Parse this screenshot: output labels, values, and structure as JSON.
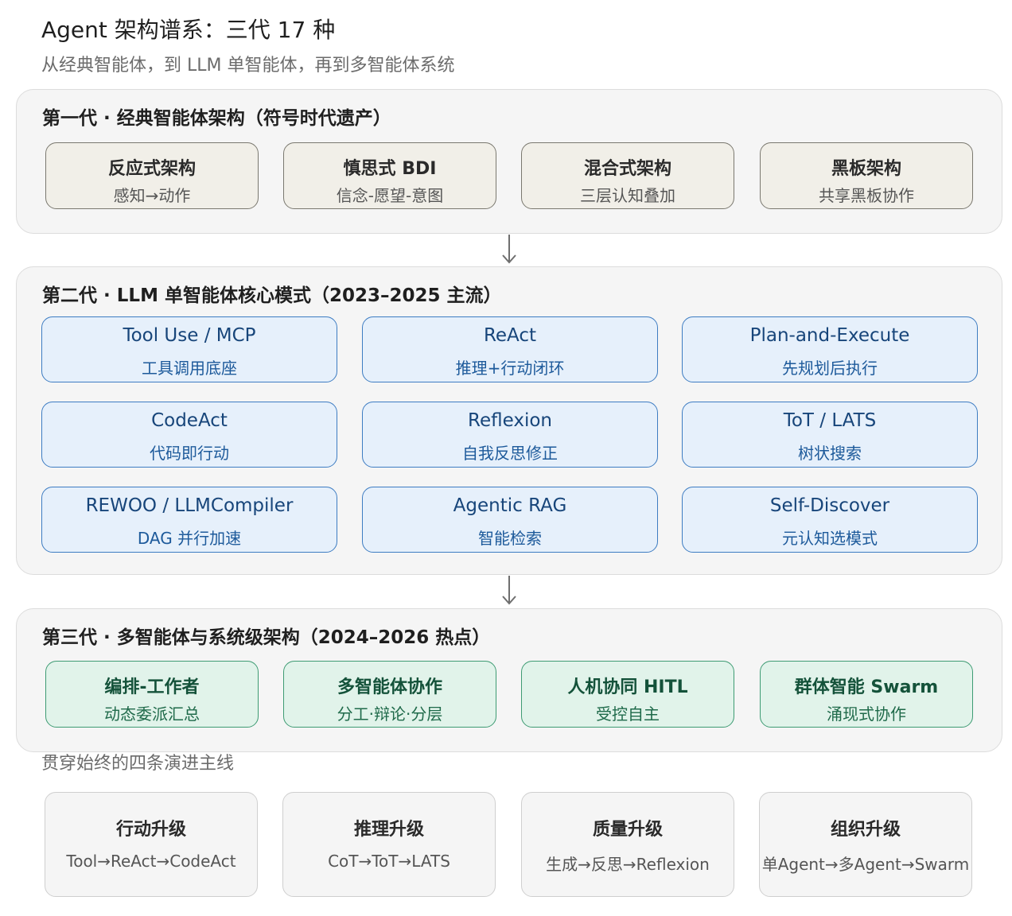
{
  "header": {
    "title": "Agent 架构谱系：三代 17 种",
    "subtitle": "从经典智能体，到 LLM 单智能体，再到多智能体系统"
  },
  "gen1": {
    "title": "第一代 · 经典智能体架构（符号时代遗产）",
    "cards": [
      {
        "name": "反应式架构",
        "desc": "感知→动作"
      },
      {
        "name": "慎思式 BDI",
        "desc": "信念-愿望-意图"
      },
      {
        "name": "混合式架构",
        "desc": "三层认知叠加"
      },
      {
        "name": "黑板架构",
        "desc": "共享黑板协作"
      }
    ]
  },
  "gen2": {
    "title": "第二代 · LLM 单智能体核心模式（2023–2025 主流）",
    "cards": [
      {
        "name": "Tool Use / MCP",
        "desc": "工具调用底座"
      },
      {
        "name": "ReAct",
        "desc": "推理+行动闭环"
      },
      {
        "name": "Plan-and-Execute",
        "desc": "先规划后执行"
      },
      {
        "name": "CodeAct",
        "desc": "代码即行动"
      },
      {
        "name": "Reflexion",
        "desc": "自我反思修正"
      },
      {
        "name": "ToT / LATS",
        "desc": "树状搜索"
      },
      {
        "name": "REWOO / LLMCompiler",
        "desc": "DAG 并行加速"
      },
      {
        "name": "Agentic RAG",
        "desc": "智能检索"
      },
      {
        "name": "Self-Discover",
        "desc": "元认知选模式"
      }
    ]
  },
  "gen3": {
    "title": "第三代 · 多智能体与系统级架构（2024–2026 热点）",
    "cards": [
      {
        "name": "编排-工作者",
        "desc": "动态委派汇总"
      },
      {
        "name": "多智能体协作",
        "desc": "分工·辩论·分层"
      },
      {
        "name": "人机协同 HITL",
        "desc": "受控自主"
      },
      {
        "name": "群体智能 Swarm",
        "desc": "涌现式协作"
      }
    ]
  },
  "threads": {
    "label": "贯穿始终的四条演进主线",
    "cards": [
      {
        "name": "行动升级",
        "desc": "Tool→ReAct→CodeAct"
      },
      {
        "name": "推理升级",
        "desc": "CoT→ToT→LATS"
      },
      {
        "name": "质量升级",
        "desc": "生成→反思→Reflexion"
      },
      {
        "name": "组织升级",
        "desc": "单Agent→多Agent→Swarm"
      }
    ]
  }
}
